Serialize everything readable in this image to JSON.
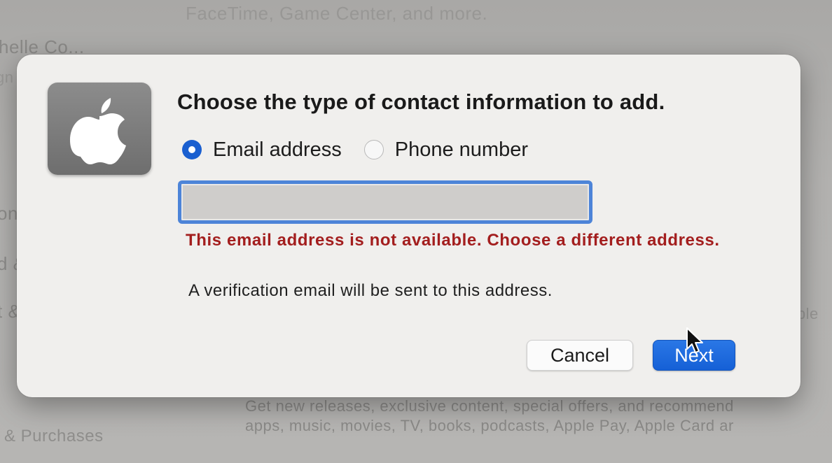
{
  "background": {
    "top_text": "FaceTime, Game Center, and more.",
    "left_fragments": [
      "helle Co...",
      "gn",
      "on",
      "d &",
      "t & S"
    ],
    "right_fragment": "Apple",
    "bottom_line_1": "Get new releases, exclusive content, special offers, and recommend",
    "bottom_line_2": "apps, music, movies, TV, books, podcasts, Apple Pay, Apple Card ar",
    "purchases_label": "& Purchases"
  },
  "dialog": {
    "icon": "apple-logo-icon",
    "title": "Choose the type of contact information to add.",
    "options": [
      {
        "label": "Email address",
        "selected": true
      },
      {
        "label": "Phone number",
        "selected": false
      }
    ],
    "email_field": {
      "value": "",
      "placeholder": ""
    },
    "error_message": "This email address is not available. Choose a different address.",
    "info_message": "A verification email will be sent to this address.",
    "cancel_label": "Cancel",
    "next_label": "Next"
  },
  "colors": {
    "accent": "#1a5fd0",
    "error": "#a31e1e",
    "focus_ring": "#4d84d8"
  }
}
